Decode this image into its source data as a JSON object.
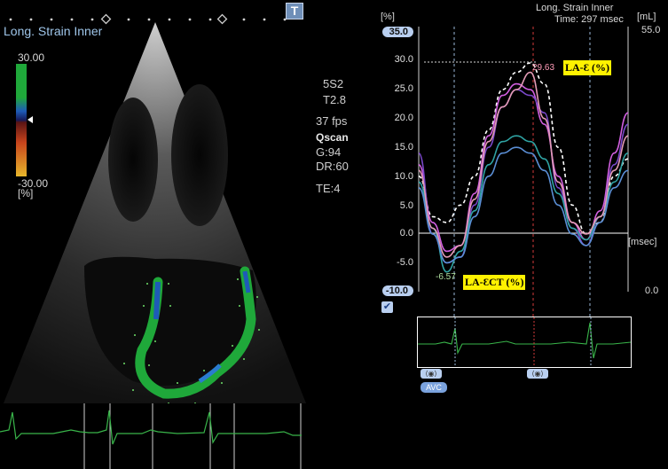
{
  "left": {
    "title": "Long. Strain Inner",
    "t_button": "T",
    "scale_max": "30.00",
    "scale_min": "-30.00",
    "scale_unit": "[%]",
    "params": [
      "5S2",
      "T2.8",
      "37 fps",
      "Qscan",
      "G:94",
      "DR:60",
      "",
      "TE:4"
    ]
  },
  "right": {
    "title": "Long. Strain Inner",
    "time": "Time: 297 msec",
    "y_unit": "[%]",
    "y2_unit": "[mL]",
    "y2_max": "55.0",
    "y2_min": "0.0",
    "x_unit": "[msec]",
    "y_top_btn": "35.0",
    "y_bottom_btn": "-10.0",
    "ticks": [
      "30.0",
      "25.0",
      "20.0",
      "15.0",
      "10.0",
      "5.0",
      "0.0",
      "-5.0"
    ],
    "peak_label": "29.63",
    "min_label": "-6.57",
    "callout_peak": "LA-Ɛ (%)",
    "callout_ct": "LA-ƐCT (%)",
    "avc": "AVC",
    "check": "✔"
  },
  "colors": {
    "background": "#000000",
    "scale_green": "#1fa83a",
    "scale_orange": "#c8441c",
    "button_blue": "#b9cff0",
    "callout_yellow": "#fff200",
    "curve_white": "#ffffff",
    "curve_magenta": "#d25fe0",
    "curve_purple": "#7a48c9",
    "curve_teal": "#2fa3a3",
    "curve_pink": "#e39bb5",
    "ecg_green": "#39b54a"
  },
  "chart_data": {
    "type": "line",
    "title": "Long. Strain Inner",
    "xlabel": "[msec]",
    "ylabel": "[%]",
    "ylim": [
      -10,
      35
    ],
    "yticks": [
      30,
      25,
      20,
      15,
      10,
      5,
      0,
      -5
    ],
    "peak_value": 29.63,
    "min_value": -6.57,
    "series": [
      {
        "name": "",
        "color": "#ffffff",
        "dashed": true,
        "values": [
          10,
          3,
          2,
          5,
          10,
          18,
          25,
          28,
          29.63,
          26,
          15,
          5,
          0,
          2,
          10,
          13
        ]
      },
      {
        "name": "",
        "color": "#d25fe0",
        "dashed": false,
        "values": [
          12,
          2,
          -3,
          -2,
          7,
          17,
          24,
          26,
          25,
          19,
          10,
          2,
          -1,
          4,
          14,
          21
        ]
      },
      {
        "name": "",
        "color": "#7a48c9",
        "dashed": false,
        "values": [
          14,
          0,
          -5,
          -4,
          5,
          15,
          22,
          25,
          24,
          21,
          8,
          1,
          -2,
          3,
          12,
          19
        ]
      },
      {
        "name": "",
        "color": "#2fa3a3",
        "dashed": false,
        "values": [
          9,
          1,
          -6.57,
          -3,
          4,
          12,
          16,
          17,
          16,
          13,
          7,
          1,
          -1,
          3,
          9,
          14
        ]
      },
      {
        "name": "",
        "color": "#e39bb5",
        "dashed": false,
        "values": [
          11,
          1,
          -4,
          -2,
          6,
          16,
          22,
          25,
          28,
          20,
          9,
          2,
          0,
          3,
          11,
          17
        ]
      },
      {
        "name": "",
        "color": "#5b8fd6",
        "dashed": false,
        "values": [
          8,
          0,
          -5,
          -4,
          3,
          10,
          14,
          15,
          14,
          11,
          5,
          0,
          -2,
          2,
          8,
          11
        ]
      }
    ]
  }
}
